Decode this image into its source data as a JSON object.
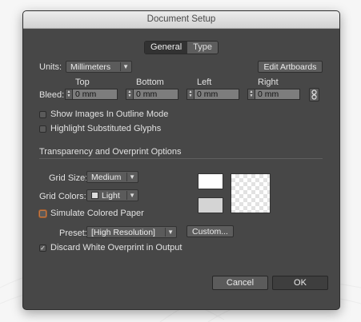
{
  "window": {
    "title": "Document Setup"
  },
  "tabs": [
    {
      "label": "General",
      "active": true
    },
    {
      "label": "Type",
      "active": false
    }
  ],
  "units": {
    "label": "Units:",
    "value": "Millimeters"
  },
  "edit_artboards_label": "Edit Artboards",
  "bleed": {
    "label": "Bleed:",
    "top": {
      "label": "Top",
      "value": "0 mm"
    },
    "bottom": {
      "label": "Bottom",
      "value": "0 mm"
    },
    "left": {
      "label": "Left",
      "value": "0 mm"
    },
    "right": {
      "label": "Right",
      "value": "0 mm"
    },
    "link_icon": "link-icon"
  },
  "checkboxes": {
    "outline_mode": {
      "label": "Show Images In Outline Mode",
      "checked": false
    },
    "substituted_glyphs": {
      "label": "Highlight Substituted Glyphs",
      "checked": false
    },
    "simulate_paper": {
      "label": "Simulate Colored Paper",
      "checked": false
    },
    "discard_white": {
      "label": "Discard White Overprint in Output",
      "checked": true
    }
  },
  "transparency": {
    "section_title": "Transparency and Overprint Options",
    "grid_size": {
      "label": "Grid Size:",
      "value": "Medium"
    },
    "grid_colors": {
      "label": "Grid Colors:",
      "value": "Light",
      "swatch_color": "#dcdcdc"
    },
    "preset": {
      "label": "Preset:",
      "value": "[High Resolution]"
    },
    "custom_label": "Custom..."
  },
  "footer": {
    "cancel_label": "Cancel",
    "ok_label": "OK"
  },
  "colors": {
    "dialog_bg": "#474747",
    "field_bg": "#7d7d7d",
    "ok_bg": "#3e3e3e",
    "focus_orange": "#c07a4a"
  }
}
